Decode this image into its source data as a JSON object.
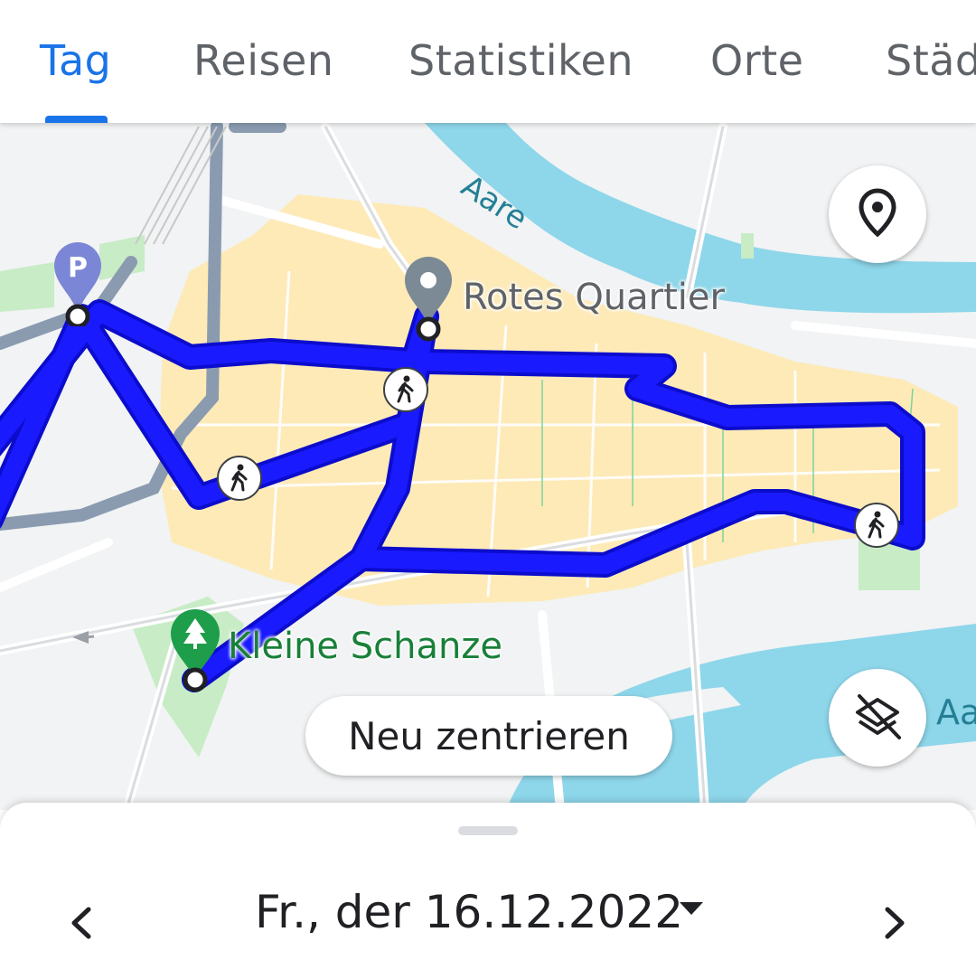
{
  "tabs": [
    {
      "label": "Tag",
      "active": true
    },
    {
      "label": "Reisen",
      "active": false
    },
    {
      "label": "Statistiken",
      "active": false
    },
    {
      "label": "Orte",
      "active": false
    },
    {
      "label": "Städ",
      "active": false
    }
  ],
  "map": {
    "places": {
      "rotes_quartier": "Rotes Quartier",
      "kleine_schanze": "Kleine Schanze",
      "parking_letter": "P"
    },
    "water_labels": {
      "aare": "Aare",
      "aare_partial": "Aa"
    },
    "recenter_label": "Neu zentrieren",
    "icons": [
      "location-pin-icon",
      "layers-off-icon",
      "walking-icon",
      "parking-icon",
      "park-tree-icon"
    ]
  },
  "sheet": {
    "date": "Fr., der 16.12.2022",
    "icons": [
      "chevron-left-icon",
      "chevron-right-icon",
      "dropdown-arrow-icon"
    ]
  },
  "colors": {
    "accent": "#1a73e8",
    "route": "#1a1aff",
    "water": "#8ed6ea",
    "district": "#fdeab7",
    "park": "#c8ecc6"
  }
}
